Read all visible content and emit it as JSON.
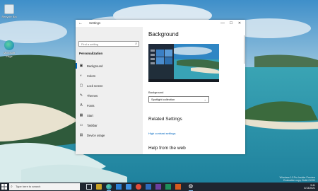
{
  "desktop": {
    "icons": [
      {
        "name": "recycle-bin-icon",
        "label": "Recycle Bin"
      },
      {
        "name": "edge-icon",
        "label": "Microsoft Edge"
      }
    ]
  },
  "window": {
    "title": "Settings",
    "back_icon": "back-arrow-icon",
    "controls": {
      "minimize": "—",
      "maximize": "☐",
      "close": "✕"
    }
  },
  "nav": {
    "search_placeholder": "Find a setting",
    "section": "Personalization",
    "items": [
      {
        "label": "Background",
        "icon": "picture-icon",
        "glyph": "▣",
        "active": true
      },
      {
        "label": "Colors",
        "icon": "palette-icon",
        "glyph": "◐",
        "active": false
      },
      {
        "label": "Lock screen",
        "icon": "lock-screen-icon",
        "glyph": "▢",
        "active": false
      },
      {
        "label": "Themes",
        "icon": "brush-icon",
        "glyph": "✎",
        "active": false
      },
      {
        "label": "Fonts",
        "icon": "fonts-icon",
        "glyph": "A",
        "active": false
      },
      {
        "label": "Start",
        "icon": "start-icon",
        "glyph": "▦",
        "active": false
      },
      {
        "label": "Taskbar",
        "icon": "taskbar-icon",
        "glyph": "▭",
        "active": false
      },
      {
        "label": "Device usage",
        "icon": "device-usage-icon",
        "glyph": "▤",
        "active": false
      }
    ]
  },
  "content": {
    "title": "Background",
    "background_label": "Background",
    "background_value": "Spotlight collection",
    "related_heading": "Related Settings",
    "related_link": "High contrast settings",
    "help_heading": "Help from the web"
  },
  "taskbar": {
    "search_placeholder": "Type here to search",
    "tray_line1": "9:41",
    "tray_line2": "6/13/2021"
  },
  "watermark": {
    "line1": "Windows 10 Pro Insider Preview",
    "line2": "Evaluation copy. Build 21390"
  },
  "colors": {
    "accent": "#0067c0",
    "taskbar": "#1f2630",
    "nav_bg": "#efefef"
  }
}
